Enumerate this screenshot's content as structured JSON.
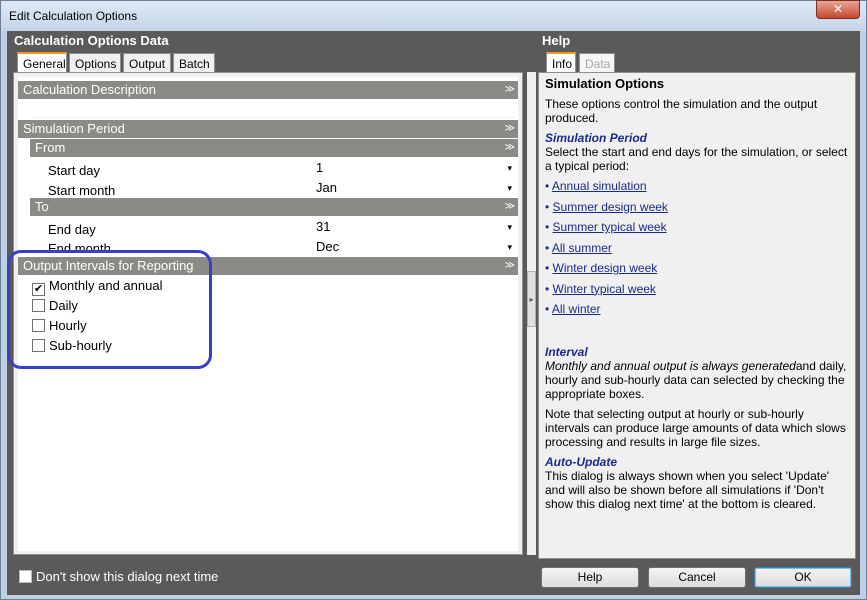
{
  "window": {
    "title": "Edit Calculation Options",
    "close_glyph": "✕"
  },
  "left": {
    "header": "Calculation Options Data",
    "tabs": [
      "General",
      "Options",
      "Output",
      "Batch"
    ],
    "active_tab": "General",
    "sections": {
      "calc_desc": "Calculation Description",
      "sim_period": "Simulation Period",
      "from": "From",
      "to": "To",
      "output_intervals": "Output Intervals for Reporting"
    },
    "fields": {
      "start_day_label": "Start day",
      "start_day_value": "1",
      "start_month_label": "Start month",
      "start_month_value": "Jan",
      "end_day_label": "End day",
      "end_day_value": "31",
      "end_month_label": "End month",
      "end_month_value": "Dec"
    },
    "checkboxes": [
      {
        "label": "Monthly and annual",
        "checked": true
      },
      {
        "label": "Daily",
        "checked": false
      },
      {
        "label": "Hourly",
        "checked": false
      },
      {
        "label": "Sub-hourly",
        "checked": false
      }
    ],
    "collapse_glyph": "≫",
    "dropdown_glyph": "▾"
  },
  "right": {
    "header": "Help",
    "tabs": [
      "Info",
      "Data"
    ],
    "active_tab": "Info",
    "title": "Simulation Options",
    "intro": "These options control the simulation and the output produced.",
    "sim_period_heading": "Simulation Period",
    "sim_period_text": "Select the start and end days for the simulation, or select a typical period:",
    "links": [
      "Annual simulation",
      "Summer design week",
      "Summer typical week",
      "All summer",
      "Winter design week",
      "Winter typical week",
      "All winter"
    ],
    "interval_heading": "Interval",
    "interval_italic": "Monthly and annual output is always generated",
    "interval_rest": "and daily, hourly and sub-hourly data can selected by checking the appropriate boxes.",
    "note": "Note that selecting output at hourly or sub-hourly intervals can produce large amounts of data which slows processing and results in large file sizes.",
    "autoupdate_heading": "Auto-Update",
    "autoupdate_text": "This dialog is always shown when you select 'Update' and will also be shown before all simulations if 'Don't show this dialog next time' at the bottom is cleared."
  },
  "bottom": {
    "dont_show_label": "Don't show this dialog next time",
    "dont_show_checked": false,
    "help_button": "Help",
    "cancel_button": "Cancel",
    "ok_button": "OK"
  },
  "colors": {
    "section_header": "#8c8a86",
    "link": "#1a2a8c",
    "highlight_ring": "#3940c8",
    "active_tab_accent": "#f39a1e"
  }
}
